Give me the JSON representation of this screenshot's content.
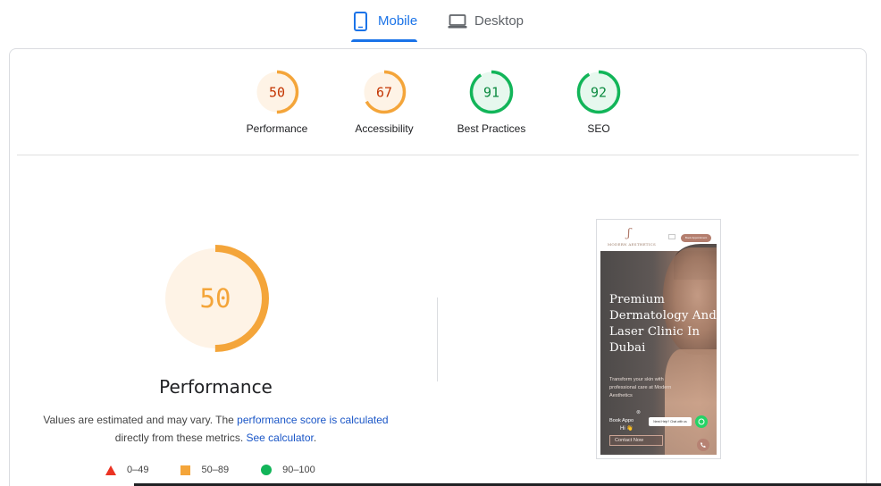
{
  "tabs": [
    {
      "label": "Mobile",
      "icon": "phone-icon",
      "selected": true
    },
    {
      "label": "Desktop",
      "icon": "laptop-icon",
      "selected": false
    }
  ],
  "categories": [
    {
      "score": "50",
      "label": "Performance",
      "value": 50,
      "status": "average"
    },
    {
      "score": "67",
      "label": "Accessibility",
      "value": 67,
      "status": "average"
    },
    {
      "score": "91",
      "label": "Best Practices",
      "value": 91,
      "status": "pass"
    },
    {
      "score": "92",
      "label": "SEO",
      "value": 92,
      "status": "pass"
    }
  ],
  "performance": {
    "score": "50",
    "value": 50,
    "title": "Performance",
    "desc_prefix": "Values are estimated and may vary. The ",
    "desc_link": "performance score is calculated",
    "desc_middle": " directly from these metrics. ",
    "desc_calc_link": "See calculator",
    "desc_suffix": "."
  },
  "legend": [
    {
      "range": "0–49",
      "shape": "triangle",
      "color": "#eb3323"
    },
    {
      "range": "50–89",
      "shape": "square",
      "color": "#f4a53a"
    },
    {
      "range": "90–100",
      "shape": "circle",
      "color": "#12b559"
    }
  ],
  "colors": {
    "average_stroke": "#f4a53a",
    "average_fill": "#fef3e6",
    "average_text": "#c33300",
    "pass_stroke": "#12b559",
    "pass_fill": "#e6f8ee",
    "pass_text": "#0a8a3f",
    "accent": "#1a73e8"
  },
  "screenshot": {
    "brand": "MODERN AESTHETICS",
    "header_button": "Book Appointment",
    "hero_title": "Premium Dermatology And Laser Clinic In Dubai",
    "hero_subtitle": "Transform your skin with professional care at Modern Aesthetics",
    "book_text": "Book Appo",
    "hi_text": "Hi 👋",
    "chat_text": "Need Help? Chat with us",
    "contact_button": "Contact Now"
  }
}
